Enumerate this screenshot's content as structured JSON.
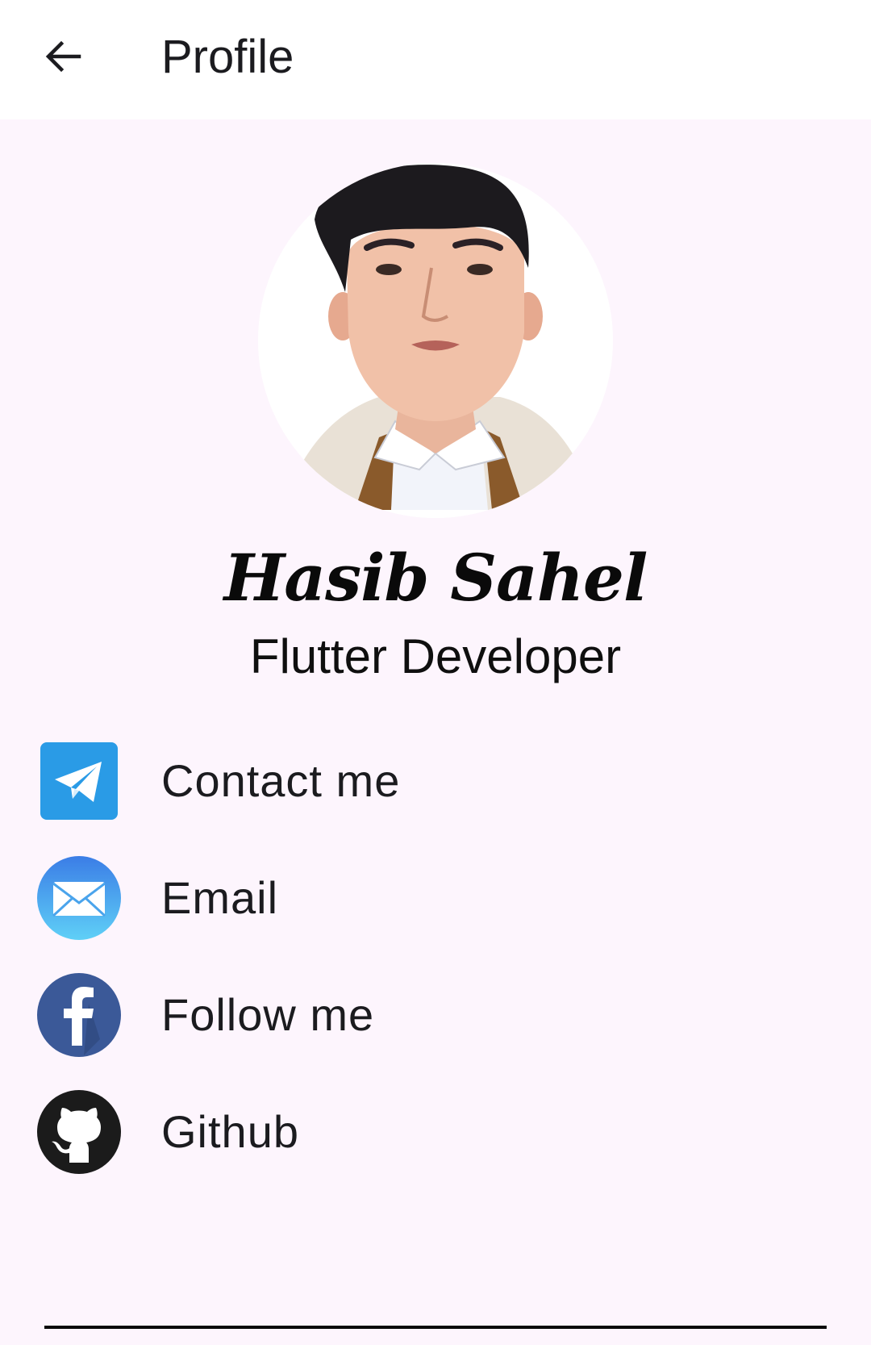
{
  "appbar": {
    "title": "Profile",
    "back_icon": "arrow-back-icon"
  },
  "profile": {
    "name": "Hasib Sahel",
    "role": "Flutter Developer",
    "avatar_icon": "profile-photo"
  },
  "links": [
    {
      "label": "Contact me",
      "icon": "telegram-icon",
      "color": "#2a9be6"
    },
    {
      "label": "Email",
      "icon": "email-icon",
      "color": "#3ea9f0"
    },
    {
      "label": "Follow me",
      "icon": "facebook-icon",
      "color": "#3b5998"
    },
    {
      "label": "Github",
      "icon": "github-icon",
      "color": "#1b1b1b"
    }
  ],
  "colors": {
    "background": "#fdf5fd",
    "appbar": "#ffffff"
  }
}
